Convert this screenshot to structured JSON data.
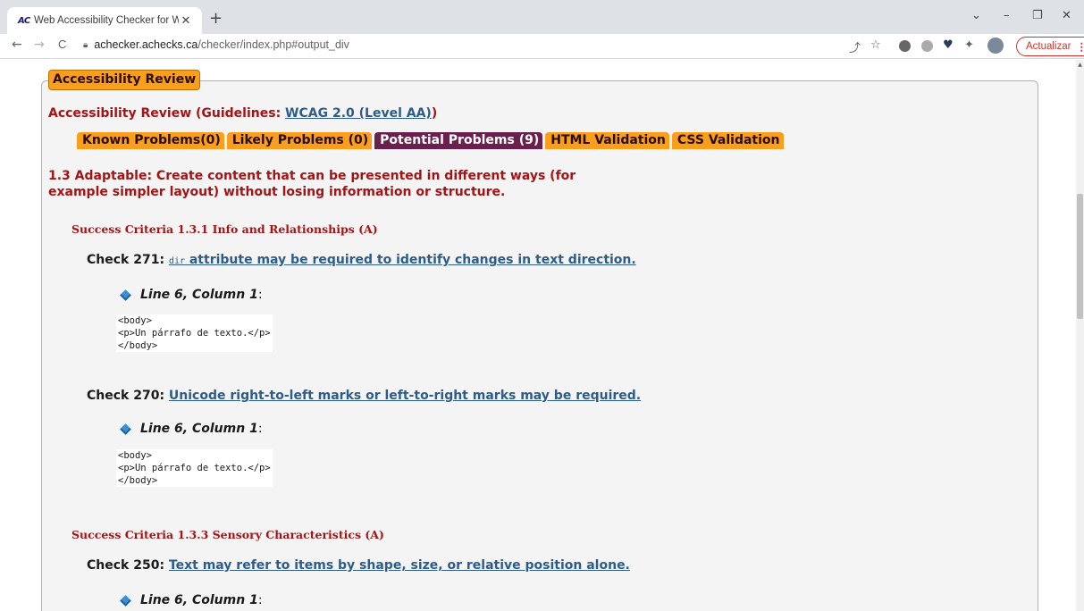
{
  "browser": {
    "tab": {
      "favicon_text": "AC",
      "title": "Web Accessibility Checker for W",
      "close_glyph": "✕"
    },
    "new_tab_glyph": "+",
    "window_controls": {
      "dropdown": "⌄",
      "minimize": "–",
      "restore": "❐",
      "close": "✕"
    },
    "nav": {
      "back": "←",
      "forward": "→",
      "reload": "C"
    },
    "url": {
      "host": "achecker.achecks.ca",
      "path": "/checker/index.php#output_div"
    },
    "update_button": {
      "label": "Actualizar",
      "menu_glyph": "⋮"
    }
  },
  "review": {
    "legend": "Accessibility Review",
    "guidelines_prefix": "Accessibility Review (Guidelines: ",
    "guidelines_link": "WCAG 2.0 (Level AA)",
    "guidelines_suffix": ")",
    "tabs": [
      {
        "label": "Known Problems(0)",
        "active": false
      },
      {
        "label": "Likely Problems (0)",
        "active": false
      },
      {
        "label": "Potential Problems (9)",
        "active": true
      },
      {
        "label": "HTML Validation",
        "active": false
      },
      {
        "label": "CSS Validation",
        "active": false
      }
    ],
    "section_heading": "1.3 Adaptable: Create content that can be presented in different ways (for example simpler layout) without losing information or structure.",
    "sc_1": {
      "title": "Success Criteria 1.3.1 Info and Relationships (A)",
      "check_271": {
        "prefix": "Check 271: ",
        "code": "dir",
        "link": " attribute may be required to identify changes in text direction.",
        "location": "Line 6, Column 1",
        "location_suffix": ":",
        "code_lines": "<body>\n<p>Un párrafo de texto.</p>\n</body>"
      },
      "check_270": {
        "prefix": "Check 270: ",
        "link": "Unicode right-to-left marks or left-to-right marks may be required.",
        "location": "Line 6, Column 1",
        "location_suffix": ":",
        "code_lines": "<body>\n<p>Un párrafo de texto.</p>\n</body>"
      }
    },
    "sc_3": {
      "title": "Success Criteria 1.3.3 Sensory Characteristics (A)",
      "check_250": {
        "prefix": "Check 250: ",
        "link": "Text may refer to items by shape, size, or relative position alone.",
        "location": "Line 6, Column 1",
        "location_suffix": ":"
      }
    }
  },
  "colors": {
    "tab_orange": "#f99e1d",
    "tab_active": "#6b1f4c",
    "heading_red": "#a41416",
    "link_blue": "#2e5c8a"
  }
}
